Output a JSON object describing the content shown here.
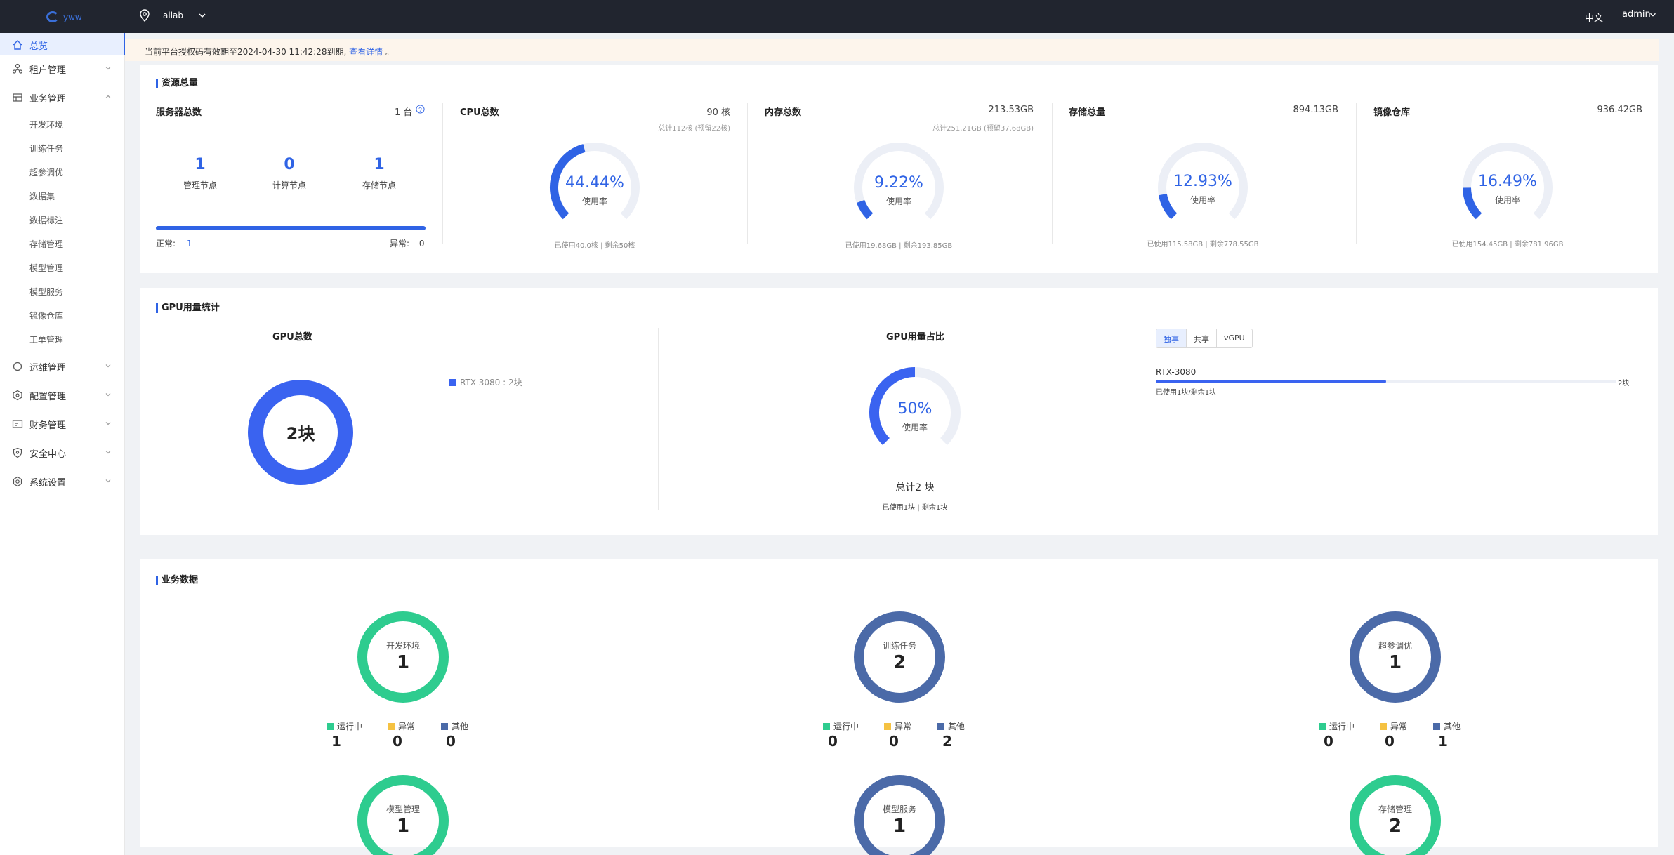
{
  "topbar": {
    "logo_text": "yww",
    "location": "ailab",
    "language": "中文",
    "user": "admin",
    "icons": {
      "location": "location-pin-icon",
      "chevron": "chevron-down-icon"
    }
  },
  "sidebar": {
    "items": [
      {
        "label": "总览",
        "icon": "home-icon",
        "active": true
      },
      {
        "label": "租户管理",
        "icon": "tenant-icon"
      },
      {
        "label": "业务管理",
        "icon": "business-icon",
        "expanded": true
      },
      {
        "label": "运维管理",
        "icon": "ops-icon"
      },
      {
        "label": "配置管理",
        "icon": "config-icon"
      },
      {
        "label": "财务管理",
        "icon": "finance-icon"
      },
      {
        "label": "安全中心",
        "icon": "security-icon"
      },
      {
        "label": "系统设置",
        "icon": "settings-icon"
      }
    ],
    "business_sub": [
      "开发环境",
      "训练任务",
      "超参调优",
      "数据集",
      "数据标注",
      "存储管理",
      "模型管理",
      "模型服务",
      "镜像仓库",
      "工单管理"
    ]
  },
  "notice": {
    "text": "当前平台授权码有效期至2024-04-30 11:42:28到期,",
    "link": "查看详情",
    "suffix": "。"
  },
  "resources": {
    "title": "资源总量",
    "server": {
      "title": "服务器总数",
      "total": "1 台",
      "nodes": [
        {
          "value": "1",
          "label": "管理节点"
        },
        {
          "value": "0",
          "label": "计算节点"
        },
        {
          "value": "1",
          "label": "存储节点"
        }
      ],
      "normal_label": "正常:",
      "normal_value": "1",
      "abnormal_label": "异常:",
      "abnormal_value": "0",
      "health_fraction": 1.0
    },
    "cpu": {
      "title": "CPU总数",
      "total": "90 核",
      "sub": "总计112核 (预留22核)",
      "percent": "44.44%",
      "percent_value": 44.44,
      "usage_label": "使用率",
      "foot": "已使用40.0核 | 剩余50核"
    },
    "memory": {
      "title": "内存总数",
      "total": "213.53GB",
      "sub": "总计251.21GB (预留37.68GB)",
      "percent": "9.22%",
      "percent_value": 9.22,
      "usage_label": "使用率",
      "foot": "已使用19.68GB | 剩余193.85GB"
    },
    "storage": {
      "title": "存储总量",
      "total": "894.13GB",
      "sub": "",
      "percent": "12.93%",
      "percent_value": 12.93,
      "usage_label": "使用率",
      "foot": "已使用115.58GB | 剩余778.55GB"
    },
    "registry": {
      "title": "镜像仓库",
      "total": "936.42GB",
      "sub": "",
      "percent": "16.49%",
      "percent_value": 16.49,
      "usage_label": "使用率",
      "foot": "已使用154.45GB | 剩余781.96GB"
    }
  },
  "gpu": {
    "title": "GPU用量统计",
    "total_title": "GPU总数",
    "total_center": "2块",
    "legend": "RTX-3080 :  2块",
    "ratio_title": "GPU用量占比",
    "ratio_percent": "50%",
    "ratio_value": 50,
    "usage_label": "使用率",
    "ratio_total": "总计2 块",
    "ratio_foot": "已使用1块 | 剩余1块",
    "tabs": [
      "独享",
      "共享",
      "vGPU"
    ],
    "active_tab": 0,
    "bar_name": "RTX-3080",
    "bar_total": "2块",
    "bar_fraction": 0.5,
    "bar_foot": "已使用1块/剩余1块"
  },
  "business": {
    "title": "业务数据",
    "legend": [
      "运行中",
      "异常",
      "其他"
    ],
    "colors": {
      "running": "#2ecc8f",
      "abnormal": "#f5c242",
      "other": "#4b6aa8"
    },
    "cards": [
      {
        "name": "开发环境",
        "total": "1",
        "ring": "#2ecc8f",
        "running": "1",
        "abnormal": "0",
        "other": "0"
      },
      {
        "name": "训练任务",
        "total": "2",
        "ring": "#4b6aa8",
        "running": "0",
        "abnormal": "0",
        "other": "2"
      },
      {
        "name": "超参调优",
        "total": "1",
        "ring": "#4b6aa8",
        "running": "0",
        "abnormal": "0",
        "other": "1"
      },
      {
        "name": "模型管理",
        "total": "1",
        "ring": "#2ecc8f"
      },
      {
        "name": "模型服务",
        "total": "1",
        "ring": "#4b6aa8"
      },
      {
        "name": "存储管理",
        "total": "2",
        "ring": "#2ecc8f"
      }
    ]
  },
  "colors": {
    "accent": "#2f63e5",
    "gauge_track": "#eceff6",
    "topbar": "#21252f"
  }
}
